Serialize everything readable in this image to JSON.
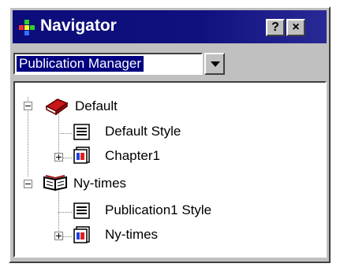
{
  "window": {
    "title": "Navigator"
  },
  "title_buttons": {
    "help": "?",
    "close": "×"
  },
  "dropdown": {
    "value": "Publication Manager"
  },
  "tree": {
    "nodes": [
      {
        "label": "Default",
        "icon": "book-icon",
        "expander": "minus"
      },
      {
        "label": "Default Style",
        "icon": "style-sheet-icon"
      },
      {
        "label": "Chapter1",
        "icon": "chapter-document-icon",
        "expander": "plus"
      },
      {
        "label": "Ny-times",
        "icon": "open-book-icon",
        "expander": "minus"
      },
      {
        "label": "Publication1 Style",
        "icon": "style-sheet-icon"
      },
      {
        "label": "Ny-times",
        "icon": "chapter-document-icon",
        "expander": "plus"
      }
    ]
  },
  "colors": {
    "titlebar": "#0c0c7a",
    "face": "#c0c0c0",
    "selection": "#000080"
  }
}
